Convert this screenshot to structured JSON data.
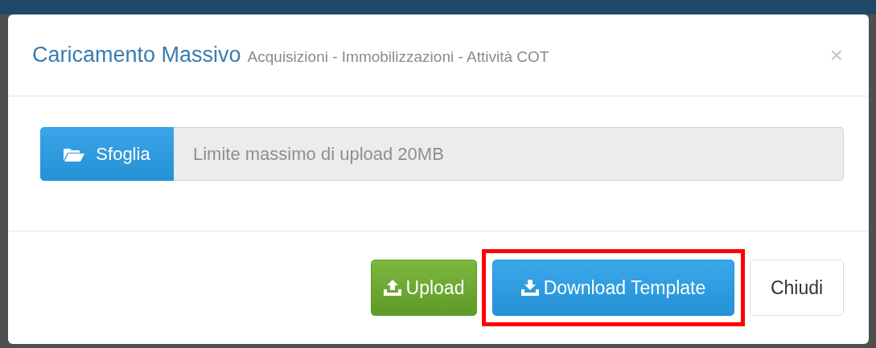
{
  "dialog": {
    "title": "Caricamento Massivo",
    "subtitle": "Acquisizioni - Immobilizzazioni - Attività COT",
    "close": "×"
  },
  "file_picker": {
    "button": "Sfoglia",
    "placeholder": "Limite massimo di upload 20MB"
  },
  "buttons": [
    {
      "kind": "upload",
      "label": "Upload",
      "highlighted": false
    },
    {
      "kind": "download",
      "label": "Download Template",
      "highlighted": true
    },
    {
      "kind": "close",
      "label": "Chiudi",
      "highlighted": false
    }
  ]
}
